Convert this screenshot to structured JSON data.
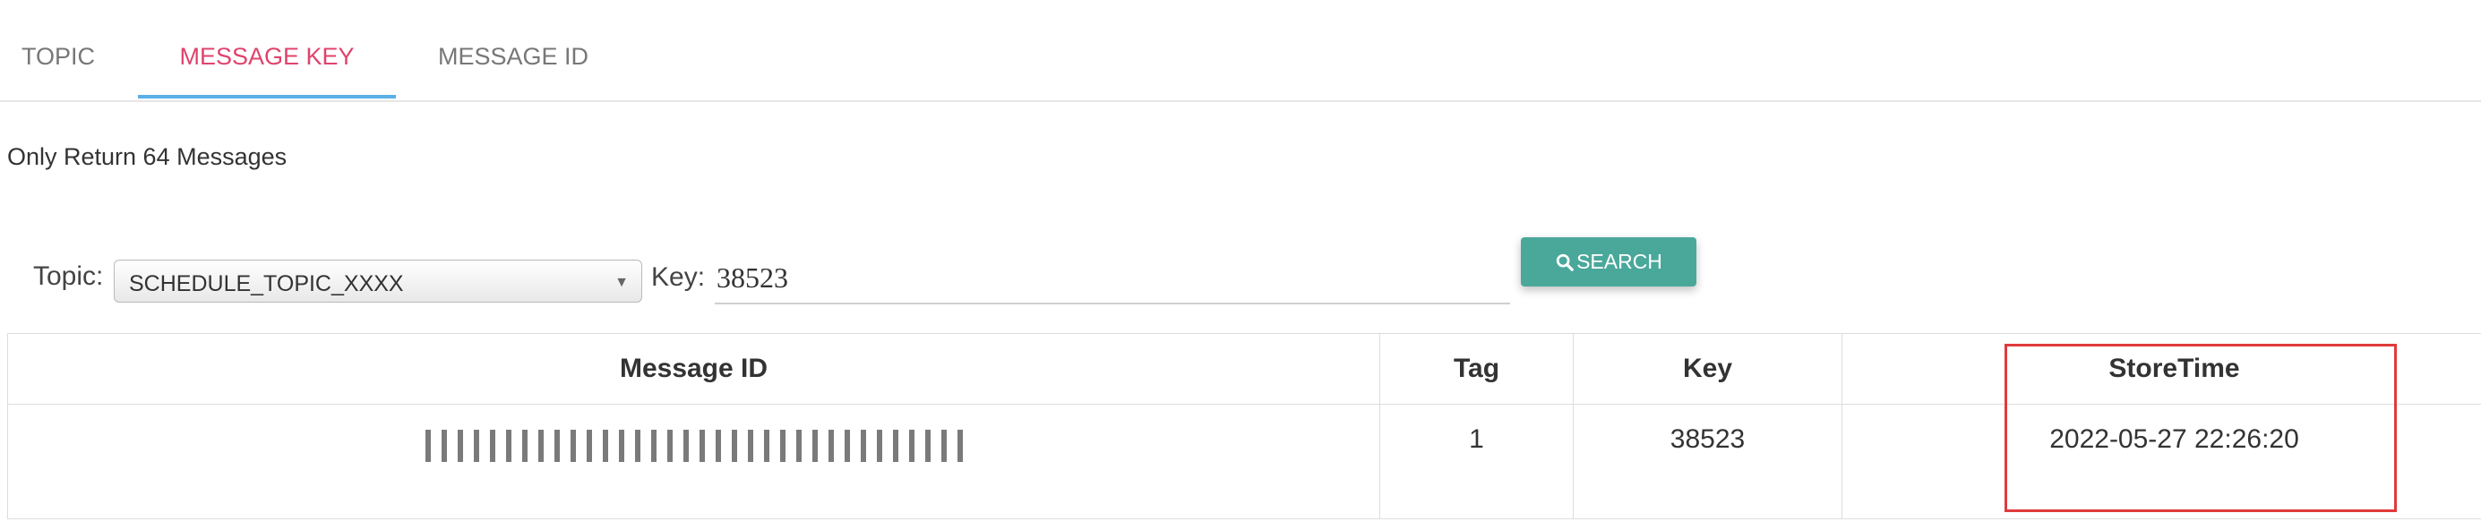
{
  "tabs": [
    {
      "label": "TOPIC",
      "active": false
    },
    {
      "label": "MESSAGE KEY",
      "active": true
    },
    {
      "label": "MESSAGE ID",
      "active": false
    }
  ],
  "note": "Only Return 64 Messages",
  "query": {
    "topic_label": "Topic:",
    "topic_value": "SCHEDULE_TOPIC_XXXX",
    "key_label": "Key:",
    "key_value": "38523",
    "search_label": "SEARCH",
    "search_icon": "search-icon"
  },
  "table": {
    "headers": [
      "Message ID",
      "Tag",
      "Key",
      "StoreTime"
    ],
    "rows": [
      {
        "message_id": "",
        "tag": "1",
        "key": "38523",
        "store_time": "2022-05-27 22:26:20"
      }
    ]
  },
  "colors": {
    "active_tab": "#e0436d",
    "tab_ink": "#5ab0e6",
    "search_button": "#4aa89b",
    "highlight_box": "#e03a3a"
  }
}
